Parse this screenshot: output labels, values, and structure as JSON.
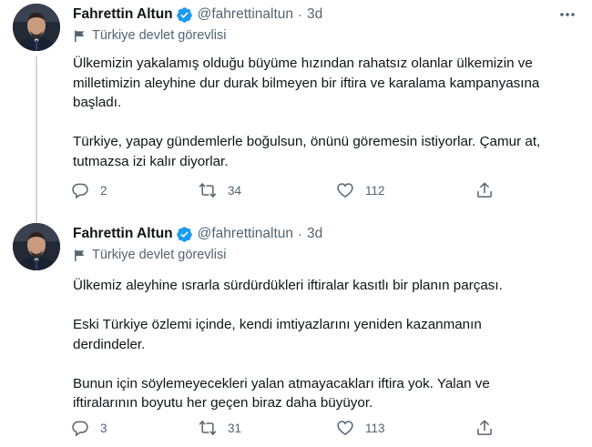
{
  "colors": {
    "text": "#0f1419",
    "secondary": "#536471",
    "verified": "#1d9bf0",
    "thread_line": "#cfd9de"
  },
  "tweets": [
    {
      "name": "Fahrettin Altun",
      "handle": "@fahrettinaltun",
      "separator": "·",
      "time": "3d",
      "label": "Türkiye devlet görevlisi",
      "paragraphs": [
        "Ülkemizin yakalamış olduğu büyüme hızından rahatsız olanlar ülkemizin ve\nmilletimizin aleyhine dur durak bilmeyen bir iftira ve karalama kampanyasına\nbaşladı.",
        "Türkiye, yapay gündemlerle boğulsun, önünü göremesin istiyorlar. Çamur at,\ntutmazsa izi kalır diyorlar."
      ],
      "replies": "2",
      "retweets": "34",
      "likes": "112",
      "icons": [
        "verified-badge-icon",
        "more-icon",
        "flag-icon",
        "reply-icon",
        "retweet-icon",
        "like-icon",
        "share-icon"
      ]
    },
    {
      "name": "Fahrettin Altun",
      "handle": "@fahrettinaltun",
      "separator": "·",
      "time": "3d",
      "label": "Türkiye devlet görevlisi",
      "paragraphs": [
        "Ülkemiz aleyhine ısrarla sürdürdükleri iftiralar kasıtlı bir planın parçası.",
        "Eski Türkiye özlemi içinde, kendi imtiyazlarını yeniden kazanmanın\nderdindeler.",
        "Bunun için söylemeyecekleri yalan atmayacakları iftira yok. Yalan ve\niftiralarının boyutu her geçen biraz daha büyüyor."
      ],
      "replies": "3",
      "retweets": "31",
      "likes": "113"
    }
  ]
}
